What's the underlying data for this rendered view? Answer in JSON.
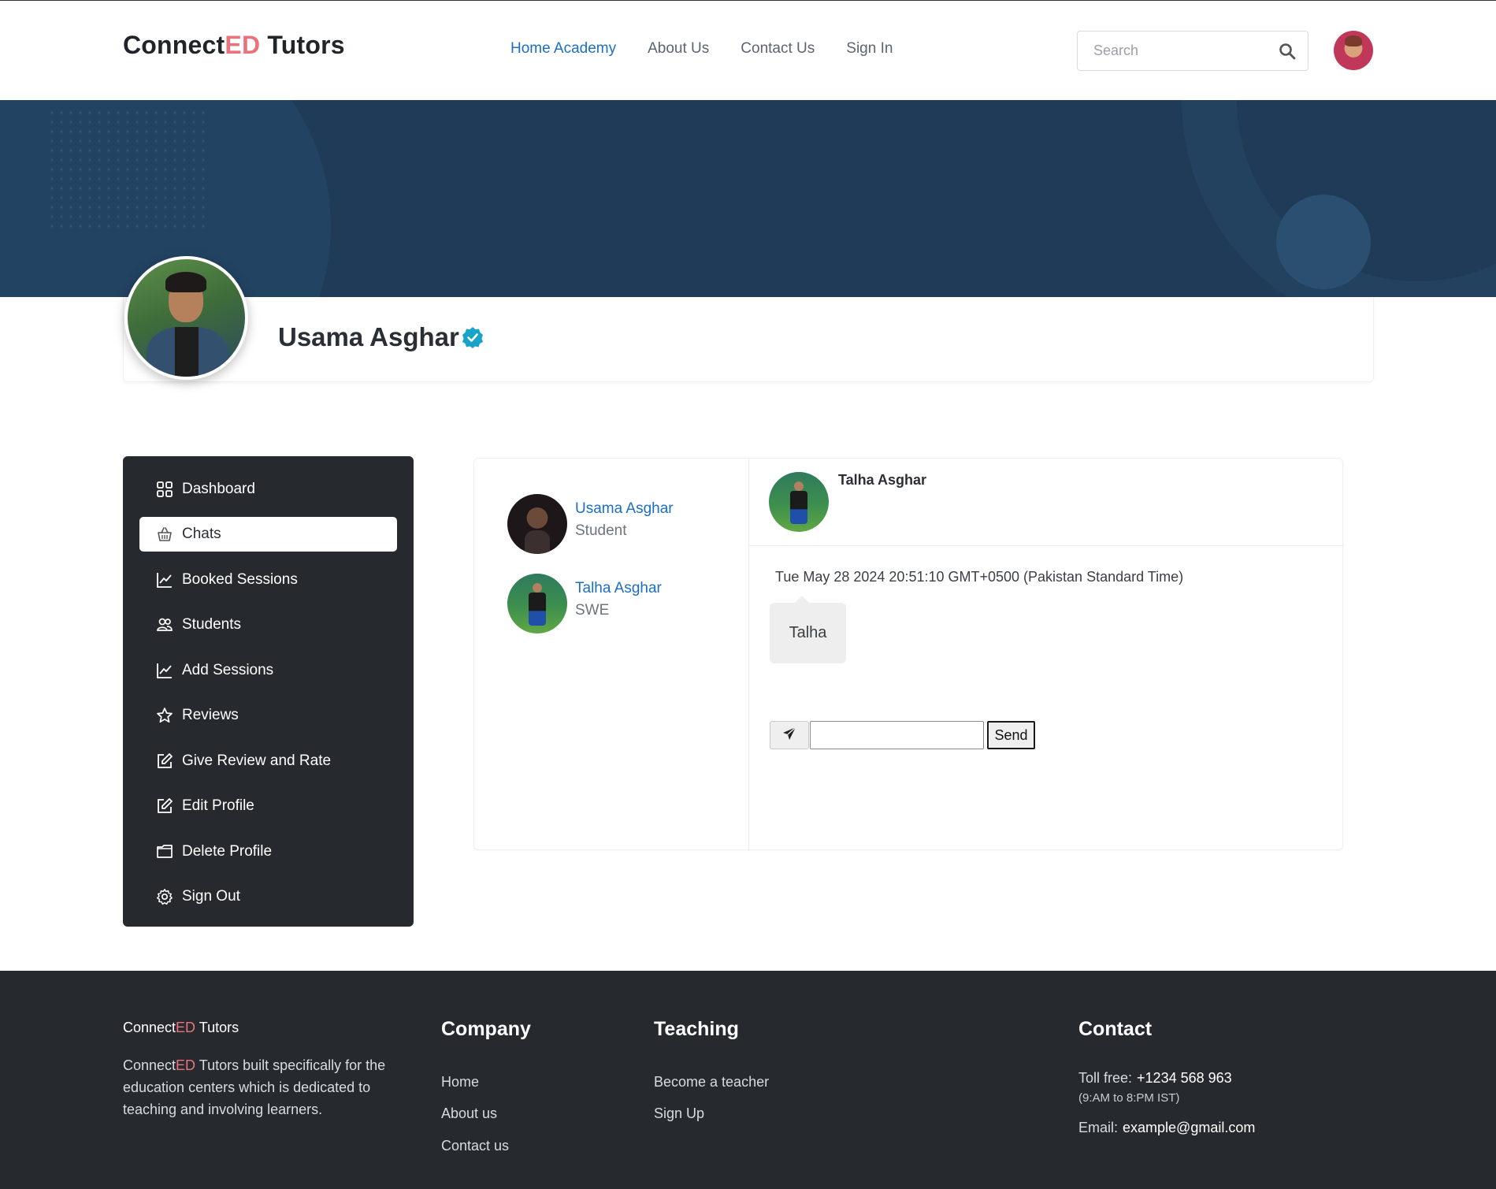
{
  "header": {
    "brand_prefix": "Connect",
    "brand_accent": "ED",
    "brand_suffix": " Tutors",
    "nav": [
      "Home Academy",
      "About Us",
      "Contact Us",
      "Sign In"
    ],
    "search_placeholder": "Search"
  },
  "profile": {
    "name": "Usama Asghar"
  },
  "sidebar": {
    "items": [
      {
        "label": "Dashboard",
        "icon": "grid-icon"
      },
      {
        "label": "Chats",
        "icon": "basket-icon"
      },
      {
        "label": "Booked Sessions",
        "icon": "chart-line-icon"
      },
      {
        "label": "Students",
        "icon": "users-icon"
      },
      {
        "label": "Add Sessions",
        "icon": "chart-line-icon"
      },
      {
        "label": "Reviews",
        "icon": "star-icon"
      },
      {
        "label": "Give Review and Rate",
        "icon": "edit-icon"
      },
      {
        "label": "Edit Profile",
        "icon": "edit-icon"
      },
      {
        "label": "Delete Profile",
        "icon": "folder-icon"
      },
      {
        "label": "Sign Out",
        "icon": "gear-icon"
      }
    ],
    "active": "Chats"
  },
  "chat": {
    "contacts": [
      {
        "name": "Usama Asghar",
        "role": "Student"
      },
      {
        "name": "Talha Asghar",
        "role": "SWE"
      }
    ],
    "active_contact": "Talha Asghar",
    "messages": [
      {
        "time": "Tue May 28 2024 20:51:10 GMT+0500 (Pakistan Standard Time)",
        "text": "Talha"
      }
    ],
    "input_value": "",
    "send_label": "Send"
  },
  "footer": {
    "brand_prefix": "Connect",
    "brand_accent": "ED",
    "brand_suffix": " Tutors",
    "desc_suffix": " Tutors built specifically for the education centers which is dedicated to teaching and involving learners.",
    "company_heading": "Company",
    "company_links": [
      "Home",
      "About us",
      "Contact us"
    ],
    "teaching_heading": "Teaching",
    "teaching_links": [
      "Become a teacher",
      "Sign Up"
    ],
    "contact_heading": "Contact",
    "toll_free_label": "Toll free:",
    "toll_free_value": "+1234 568 963",
    "hours": "(9:AM to 8:PM IST)",
    "email_label": "Email:",
    "email_value": "example@gmail.com"
  },
  "colors": {
    "accent_blue": "#1b6ec2",
    "brand_red": "#e8737a",
    "banner": "#1f3b57",
    "dark_panel": "#262a2f",
    "verified_badge": "#1aa3c8"
  }
}
